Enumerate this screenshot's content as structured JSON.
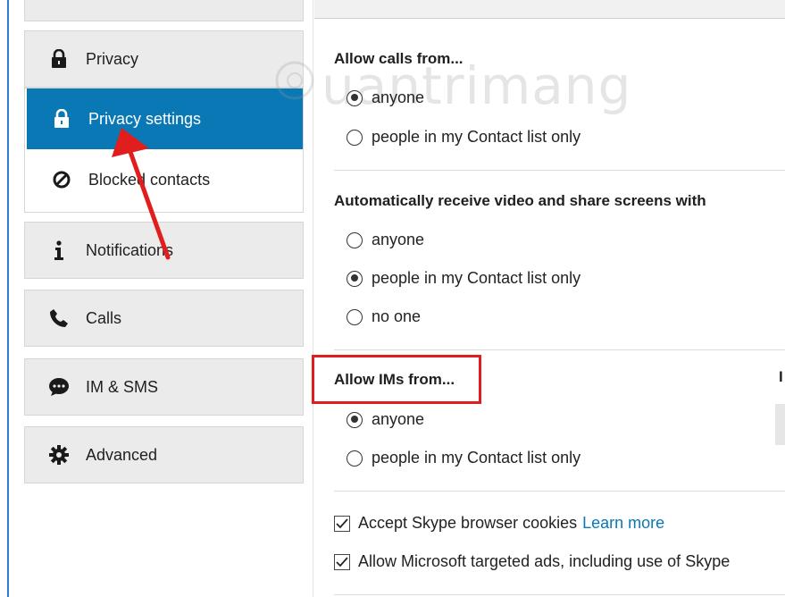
{
  "sidebar": {
    "items": [
      {
        "label": "Privacy",
        "icon": "lock-icon"
      },
      {
        "label": "Privacy settings",
        "icon": "lock-icon",
        "active": true
      },
      {
        "label": "Blocked contacts",
        "icon": "block-icon"
      },
      {
        "label": "Notifications",
        "icon": "info-icon"
      },
      {
        "label": "Calls",
        "icon": "phone-icon"
      },
      {
        "label": "IM & SMS",
        "icon": "chat-icon"
      },
      {
        "label": "Advanced",
        "icon": "gear-icon"
      }
    ]
  },
  "main": {
    "calls": {
      "heading": "Allow calls from...",
      "options": [
        "anyone",
        "people in my Contact list only"
      ],
      "selected": 0
    },
    "video": {
      "heading": "Automatically receive video and share screens with",
      "options": [
        "anyone",
        "people in my Contact list only",
        "no one"
      ],
      "selected": 1
    },
    "ims": {
      "heading": "Allow IMs from...",
      "options": [
        "anyone",
        "people in my Contact list only"
      ],
      "selected": 0
    },
    "checkboxes": [
      {
        "label": "Accept Skype browser cookies",
        "link": "Learn more",
        "checked": true
      },
      {
        "label": "Allow Microsoft targeted ads, including use of Skype",
        "checked": true
      }
    ],
    "right_stub_char": "I"
  },
  "watermark": "uantrimang",
  "colors": {
    "accent": "#0a78b5",
    "highlight": "#e01e1e",
    "link": "#0a78b5"
  }
}
